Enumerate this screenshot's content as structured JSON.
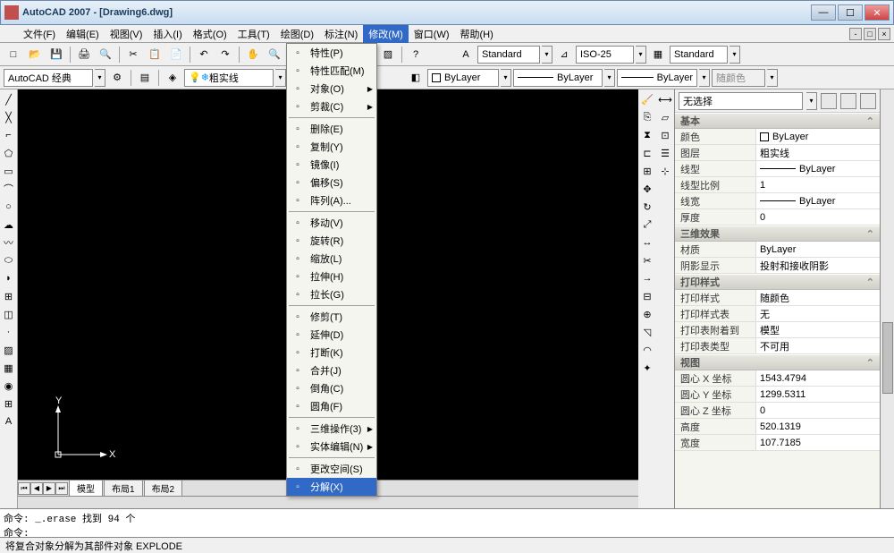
{
  "title": "AutoCAD 2007 - [Drawing6.dwg]",
  "menus": [
    "文件(F)",
    "编辑(E)",
    "视图(V)",
    "插入(I)",
    "格式(O)",
    "工具(T)",
    "绘图(D)",
    "标注(N)",
    "修改(M)",
    "窗口(W)",
    "帮助(H)"
  ],
  "active_menu": 8,
  "toolbar1": {
    "style1": "Standard",
    "style2": "ISO-25",
    "style3": "Standard"
  },
  "toolbar2": {
    "workspace": "AutoCAD 经典",
    "layer": "粗实线",
    "bylayer1": "ByLayer",
    "bylayer2": "ByLayer",
    "bylayer3": "ByLayer",
    "plotcolor": "随颜色"
  },
  "dropdown": {
    "groups": [
      {
        "items": [
          {
            "t": "特性(P)",
            "a": false
          },
          {
            "t": "特性匹配(M)",
            "a": false
          },
          {
            "t": "对象(O)",
            "a": true
          },
          {
            "t": "剪裁(C)",
            "a": true
          }
        ]
      },
      {
        "items": [
          {
            "t": "删除(E)",
            "a": false
          },
          {
            "t": "复制(Y)",
            "a": false
          },
          {
            "t": "镜像(I)",
            "a": false
          },
          {
            "t": "偏移(S)",
            "a": false
          },
          {
            "t": "阵列(A)...",
            "a": false
          }
        ]
      },
      {
        "items": [
          {
            "t": "移动(V)",
            "a": false
          },
          {
            "t": "旋转(R)",
            "a": false
          },
          {
            "t": "缩放(L)",
            "a": false
          },
          {
            "t": "拉伸(H)",
            "a": false
          },
          {
            "t": "拉长(G)",
            "a": false
          }
        ]
      },
      {
        "items": [
          {
            "t": "修剪(T)",
            "a": false
          },
          {
            "t": "延伸(D)",
            "a": false
          },
          {
            "t": "打断(K)",
            "a": false
          },
          {
            "t": "合并(J)",
            "a": false
          },
          {
            "t": "倒角(C)",
            "a": false
          },
          {
            "t": "圆角(F)",
            "a": false
          }
        ]
      },
      {
        "items": [
          {
            "t": "三维操作(3)",
            "a": true
          },
          {
            "t": "实体编辑(N)",
            "a": true
          }
        ]
      },
      {
        "items": [
          {
            "t": "更改空间(S)",
            "a": false
          },
          {
            "t": "分解(X)",
            "a": false,
            "hl": true
          }
        ]
      }
    ]
  },
  "tabs": [
    "模型",
    "布局1",
    "布局2"
  ],
  "props": {
    "selection": "无选择",
    "groups": [
      {
        "name": "基本",
        "rows": [
          {
            "l": "颜色",
            "v": "ByLayer",
            "kind": "color"
          },
          {
            "l": "图层",
            "v": "粗实线"
          },
          {
            "l": "线型",
            "v": "ByLayer",
            "kind": "line"
          },
          {
            "l": "线型比例",
            "v": "1"
          },
          {
            "l": "线宽",
            "v": "ByLayer",
            "kind": "line"
          },
          {
            "l": "厚度",
            "v": "0"
          }
        ]
      },
      {
        "name": "三维效果",
        "rows": [
          {
            "l": "材质",
            "v": "ByLayer"
          },
          {
            "l": "阴影显示",
            "v": "投射和接收阴影"
          }
        ]
      },
      {
        "name": "打印样式",
        "rows": [
          {
            "l": "打印样式",
            "v": "随颜色"
          },
          {
            "l": "打印样式表",
            "v": "无"
          },
          {
            "l": "打印表附着到",
            "v": "模型"
          },
          {
            "l": "打印表类型",
            "v": "不可用"
          }
        ]
      },
      {
        "name": "视图",
        "rows": [
          {
            "l": "圆心 X 坐标",
            "v": "1543.4794"
          },
          {
            "l": "圆心 Y 坐标",
            "v": "1299.5311"
          },
          {
            "l": "圆心 Z 坐标",
            "v": "0"
          },
          {
            "l": "高度",
            "v": "520.1319"
          },
          {
            "l": "宽度",
            "v": "107.7185"
          }
        ]
      }
    ]
  },
  "cmd1": "命令: _.erase 找到 94 个",
  "cmd2": "命令:",
  "status": "将复合对象分解为其部件对象   EXPLODE"
}
